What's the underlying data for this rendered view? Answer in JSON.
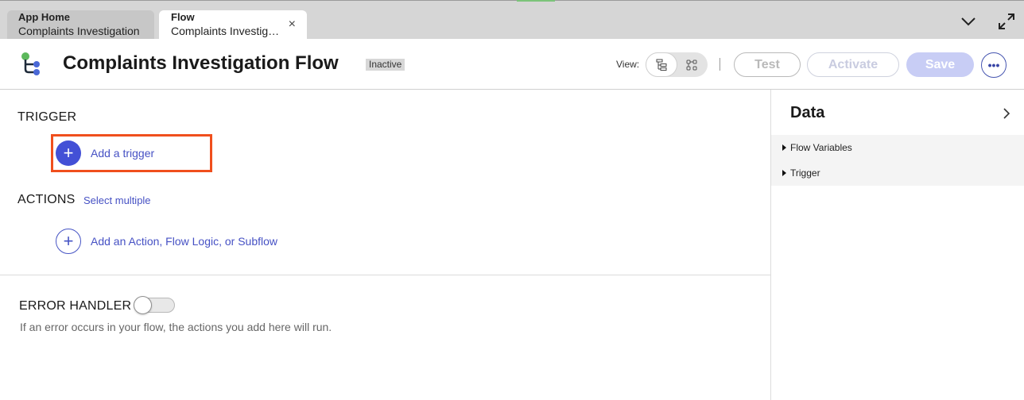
{
  "tabs": [
    {
      "label": "App Home",
      "subtitle": "Complaints Investigation"
    },
    {
      "label": "Flow",
      "subtitle": "Complaints Investigation Flow",
      "close": "×"
    }
  ],
  "header": {
    "title": "Complaints Investigation Flow",
    "status": "Inactive",
    "view_label": "View:",
    "test_label": "Test",
    "activate_label": "Activate",
    "save_label": "Save",
    "more_label": "•••"
  },
  "trigger": {
    "heading": "TRIGGER",
    "add_label": "Add a trigger",
    "highlight_color": "#f04f1d"
  },
  "actions": {
    "heading": "ACTIONS",
    "select_multiple": "Select multiple",
    "add_label": "Add an Action, Flow Logic, or Subflow"
  },
  "error_handler": {
    "heading": "ERROR HANDLER",
    "enabled": false,
    "help": "If an error occurs in your flow, the actions you add here will run."
  },
  "data_panel": {
    "title": "Data",
    "items": [
      {
        "label": "Flow Variables"
      },
      {
        "label": "Trigger"
      }
    ]
  },
  "colors": {
    "accent": "#4350d6",
    "link": "#4651c4",
    "save_disabled": "#c8cdf5"
  },
  "icons": {
    "tab_close": "close-icon",
    "collapse": "chevron-down-icon",
    "fullscreen": "expand-icon",
    "logo": "flow-logo-icon",
    "view_tree": "tree-view-icon",
    "view_diagram": "diagram-view-icon",
    "panel_expand": "chevron-right-icon"
  }
}
